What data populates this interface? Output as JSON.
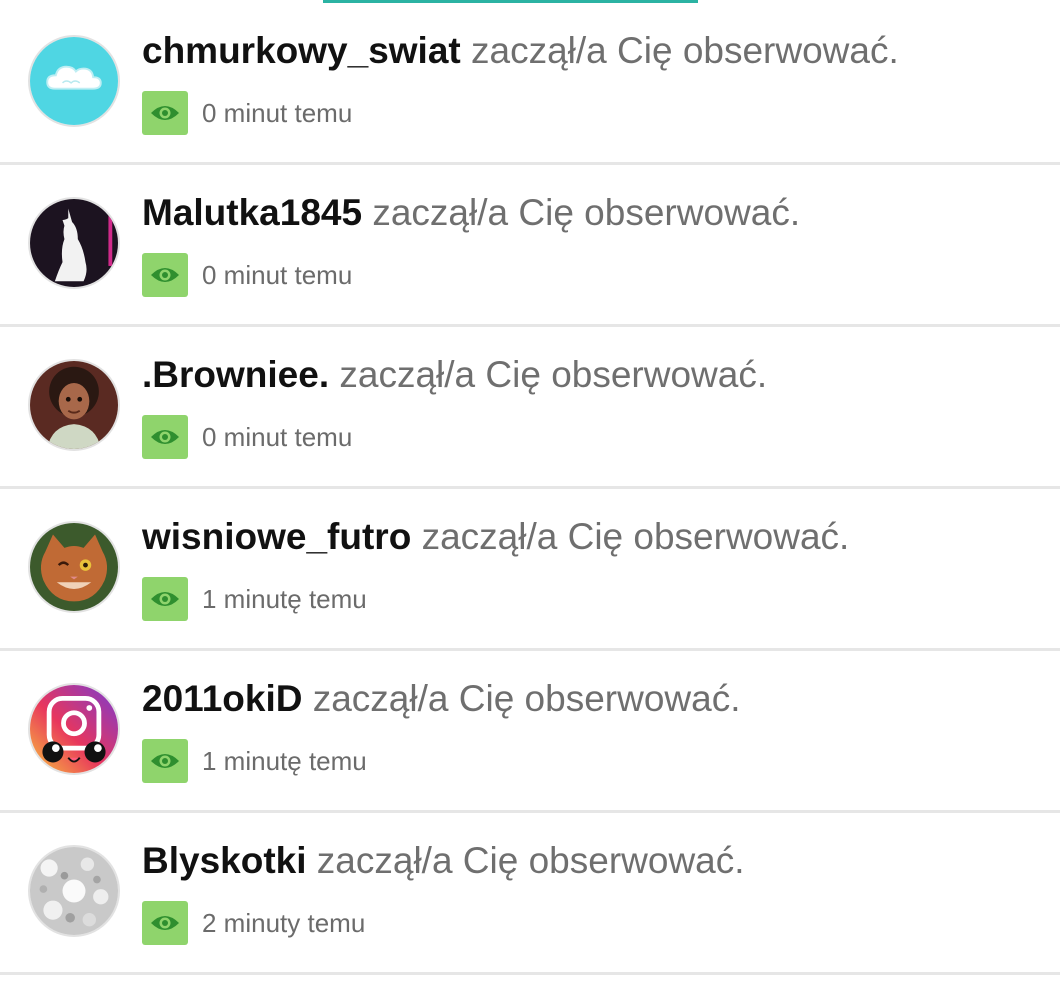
{
  "notifications": [
    {
      "username": "chmurkowy_swiat",
      "action": "zaczął/a Cię obserwować.",
      "time": "0 minut temu",
      "avatar_icon": "cloud-avatar-icon"
    },
    {
      "username": "Malutka1845",
      "action": "zaczął/a Cię obserwować.",
      "time": "0 minut temu",
      "avatar_icon": "wolf-silhouette-avatar-icon"
    },
    {
      "username": ".Browniee.",
      "action": "zaczął/a Cię obserwować.",
      "time": "0 minut temu",
      "avatar_icon": "cartoon-boy-avatar-icon"
    },
    {
      "username": "wisniowe_futro",
      "action": "zaczął/a Cię obserwować.",
      "time": "1 minutę temu",
      "avatar_icon": "cat-avatar-icon"
    },
    {
      "username": "2011okiD",
      "action": "zaczął/a Cię obserwować.",
      "time": "1 minutę temu",
      "avatar_icon": "instagram-kawaii-avatar-icon"
    },
    {
      "username": "Blyskotki",
      "action": "zaczął/a Cię obserwować.",
      "time": "2 minuty temu",
      "avatar_icon": "glitter-avatar-icon"
    }
  ],
  "colors": {
    "accent": "#2bb3a3",
    "eye_badge": "#8fd46c",
    "eye_icon": "#2f8f2f",
    "username": "#111111",
    "secondary_text": "#6f6f6f",
    "divider": "#e6e6e6"
  },
  "badge_icon": "eye-icon"
}
